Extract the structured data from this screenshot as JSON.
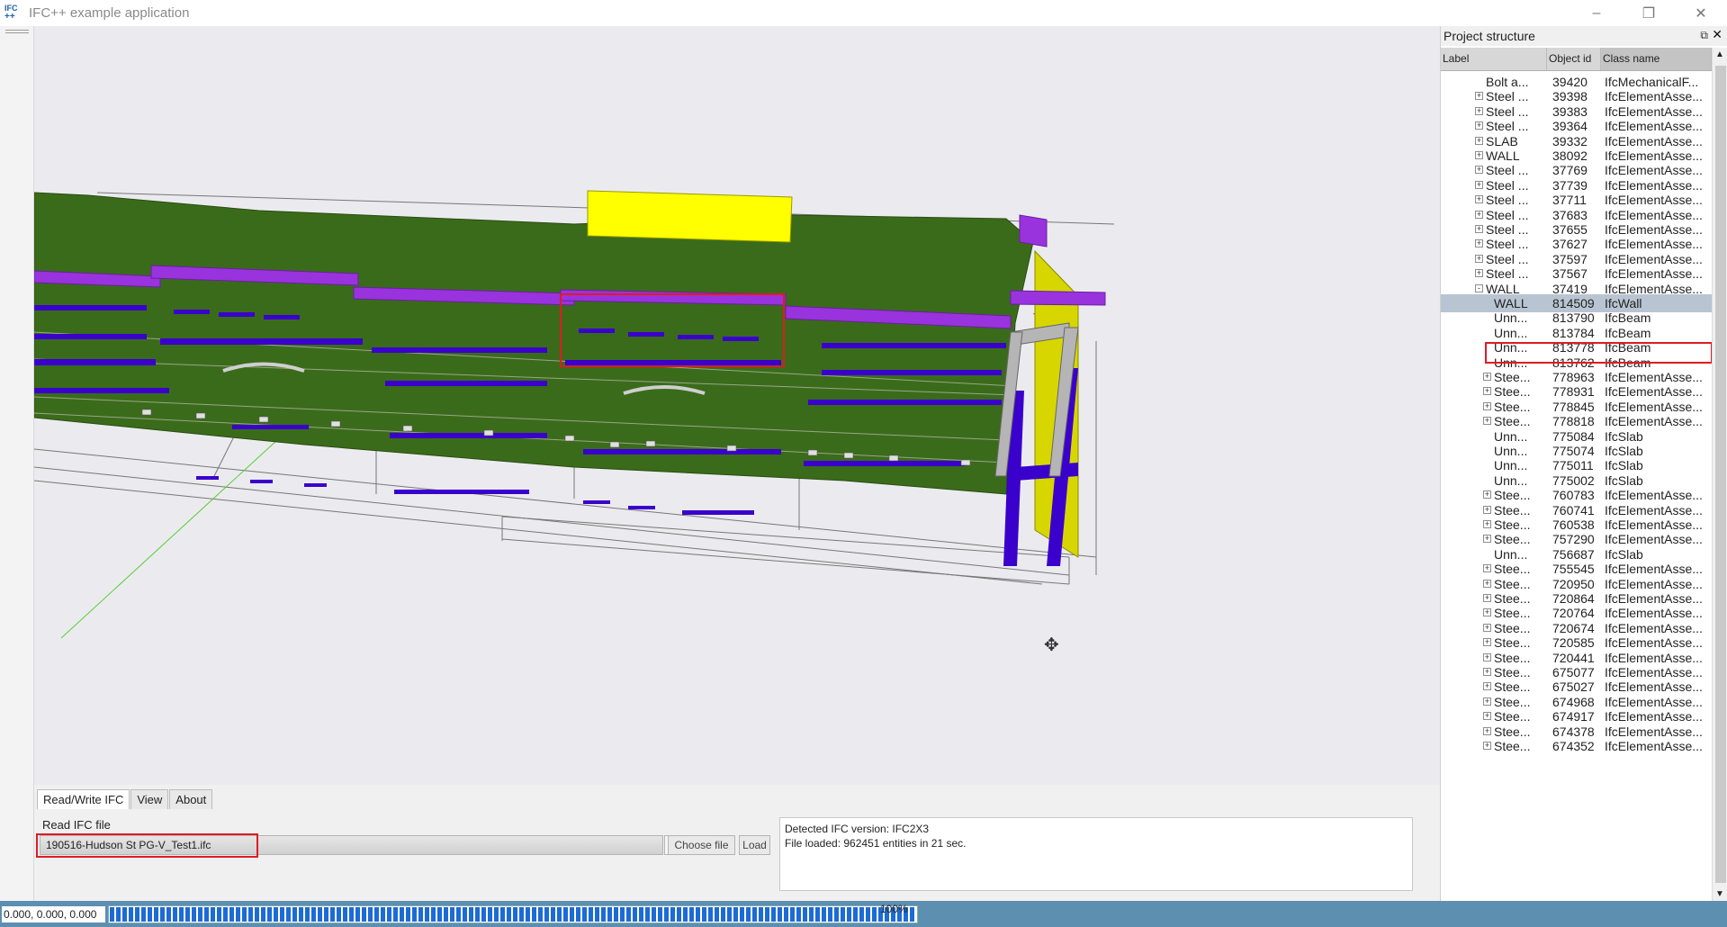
{
  "window": {
    "app_icon_top": "IFC",
    "app_icon_bottom": "++",
    "title": "IFC++ example application",
    "minimize": "–",
    "maximize": "❐",
    "close": "✕"
  },
  "viewport": {
    "description_icon": "move-cursor-icon",
    "cursor_glyph": "✥"
  },
  "tabs": [
    "Read/Write IFC",
    "View",
    "About"
  ],
  "read_ifc": {
    "section_label": "Read IFC file",
    "file_value": "190516-Hudson St PG-V_Test1.ifc",
    "choose_file_label": "Choose file",
    "load_label": "Load"
  },
  "log": {
    "line1": "Detected IFC version: IFC2X3",
    "line2": "File loaded: 962451 entities in 21 sec."
  },
  "status": {
    "coords": "0.000, 0.000, 0.000",
    "progress_percent": 100,
    "progress_text": "100%"
  },
  "project_structure": {
    "title": "Project structure",
    "float_icon": "⧉",
    "close_icon": "✕",
    "columns": {
      "label": "Label",
      "object_id": "Object id",
      "class_name": "Class name"
    },
    "rows": [
      {
        "depth": 0,
        "exp": "",
        "label": "Bolt a...",
        "id": "39420",
        "cls": "IfcMechanicalF..."
      },
      {
        "depth": 0,
        "exp": "+",
        "label": "Steel ...",
        "id": "39398",
        "cls": "IfcElementAsse..."
      },
      {
        "depth": 0,
        "exp": "+",
        "label": "Steel ...",
        "id": "39383",
        "cls": "IfcElementAsse..."
      },
      {
        "depth": 0,
        "exp": "+",
        "label": "Steel ...",
        "id": "39364",
        "cls": "IfcElementAsse..."
      },
      {
        "depth": 0,
        "exp": "+",
        "label": "SLAB",
        "id": "39332",
        "cls": "IfcElementAsse..."
      },
      {
        "depth": 0,
        "exp": "+",
        "label": "WALL",
        "id": "38092",
        "cls": "IfcElementAsse..."
      },
      {
        "depth": 0,
        "exp": "+",
        "label": "Steel ...",
        "id": "37769",
        "cls": "IfcElementAsse..."
      },
      {
        "depth": 0,
        "exp": "+",
        "label": "Steel ...",
        "id": "37739",
        "cls": "IfcElementAsse..."
      },
      {
        "depth": 0,
        "exp": "+",
        "label": "Steel ...",
        "id": "37711",
        "cls": "IfcElementAsse..."
      },
      {
        "depth": 0,
        "exp": "+",
        "label": "Steel ...",
        "id": "37683",
        "cls": "IfcElementAsse..."
      },
      {
        "depth": 0,
        "exp": "+",
        "label": "Steel ...",
        "id": "37655",
        "cls": "IfcElementAsse..."
      },
      {
        "depth": 0,
        "exp": "+",
        "label": "Steel ...",
        "id": "37627",
        "cls": "IfcElementAsse..."
      },
      {
        "depth": 0,
        "exp": "+",
        "label": "Steel ...",
        "id": "37597",
        "cls": "IfcElementAsse..."
      },
      {
        "depth": 0,
        "exp": "+",
        "label": "Steel ...",
        "id": "37567",
        "cls": "IfcElementAsse..."
      },
      {
        "depth": 0,
        "exp": "-",
        "label": "WALL",
        "id": "37419",
        "cls": "IfcElementAsse..."
      },
      {
        "depth": 1,
        "exp": "",
        "label": "WALL",
        "id": "814509",
        "cls": "IfcWall",
        "selected": true
      },
      {
        "depth": 1,
        "exp": "",
        "label": "Unn...",
        "id": "813790",
        "cls": "IfcBeam"
      },
      {
        "depth": 1,
        "exp": "",
        "label": "Unn...",
        "id": "813784",
        "cls": "IfcBeam"
      },
      {
        "depth": 1,
        "exp": "",
        "label": "Unn...",
        "id": "813778",
        "cls": "IfcBeam"
      },
      {
        "depth": 1,
        "exp": "",
        "label": "Unn...",
        "id": "813762",
        "cls": "IfcBeam"
      },
      {
        "depth": 1,
        "exp": "+",
        "label": "Stee...",
        "id": "778963",
        "cls": "IfcElementAsse..."
      },
      {
        "depth": 1,
        "exp": "+",
        "label": "Stee...",
        "id": "778931",
        "cls": "IfcElementAsse..."
      },
      {
        "depth": 1,
        "exp": "+",
        "label": "Stee...",
        "id": "778845",
        "cls": "IfcElementAsse..."
      },
      {
        "depth": 1,
        "exp": "+",
        "label": "Stee...",
        "id": "778818",
        "cls": "IfcElementAsse..."
      },
      {
        "depth": 1,
        "exp": "",
        "label": "Unn...",
        "id": "775084",
        "cls": "IfcSlab"
      },
      {
        "depth": 1,
        "exp": "",
        "label": "Unn...",
        "id": "775074",
        "cls": "IfcSlab"
      },
      {
        "depth": 1,
        "exp": "",
        "label": "Unn...",
        "id": "775011",
        "cls": "IfcSlab"
      },
      {
        "depth": 1,
        "exp": "",
        "label": "Unn...",
        "id": "775002",
        "cls": "IfcSlab"
      },
      {
        "depth": 1,
        "exp": "+",
        "label": "Stee...",
        "id": "760783",
        "cls": "IfcElementAsse..."
      },
      {
        "depth": 1,
        "exp": "+",
        "label": "Stee...",
        "id": "760741",
        "cls": "IfcElementAsse..."
      },
      {
        "depth": 1,
        "exp": "+",
        "label": "Stee...",
        "id": "760538",
        "cls": "IfcElementAsse..."
      },
      {
        "depth": 1,
        "exp": "+",
        "label": "Stee...",
        "id": "757290",
        "cls": "IfcElementAsse..."
      },
      {
        "depth": 1,
        "exp": "",
        "label": "Unn...",
        "id": "756687",
        "cls": "IfcSlab"
      },
      {
        "depth": 1,
        "exp": "+",
        "label": "Stee...",
        "id": "755545",
        "cls": "IfcElementAsse..."
      },
      {
        "depth": 1,
        "exp": "+",
        "label": "Stee...",
        "id": "720950",
        "cls": "IfcElementAsse..."
      },
      {
        "depth": 1,
        "exp": "+",
        "label": "Stee...",
        "id": "720864",
        "cls": "IfcElementAsse..."
      },
      {
        "depth": 1,
        "exp": "+",
        "label": "Stee...",
        "id": "720764",
        "cls": "IfcElementAsse..."
      },
      {
        "depth": 1,
        "exp": "+",
        "label": "Stee...",
        "id": "720674",
        "cls": "IfcElementAsse..."
      },
      {
        "depth": 1,
        "exp": "+",
        "label": "Stee...",
        "id": "720585",
        "cls": "IfcElementAsse..."
      },
      {
        "depth": 1,
        "exp": "+",
        "label": "Stee...",
        "id": "720441",
        "cls": "IfcElementAsse..."
      },
      {
        "depth": 1,
        "exp": "+",
        "label": "Stee...",
        "id": "675077",
        "cls": "IfcElementAsse..."
      },
      {
        "depth": 1,
        "exp": "+",
        "label": "Stee...",
        "id": "675027",
        "cls": "IfcElementAsse..."
      },
      {
        "depth": 1,
        "exp": "+",
        "label": "Stee...",
        "id": "674968",
        "cls": "IfcElementAsse..."
      },
      {
        "depth": 1,
        "exp": "+",
        "label": "Stee...",
        "id": "674917",
        "cls": "IfcElementAsse..."
      },
      {
        "depth": 1,
        "exp": "+",
        "label": "Stee...",
        "id": "674378",
        "cls": "IfcElementAsse..."
      },
      {
        "depth": 1,
        "exp": "+",
        "label": "Stee...",
        "id": "674352",
        "cls": "IfcElementAsse..."
      }
    ]
  },
  "colors": {
    "slab_green": "#3a6b1a",
    "beam_purple": "#9933dd",
    "member_blue": "#3a00cc",
    "highlight_yellow": "#ffff00",
    "highlight_red": "#e01b24",
    "status_bar": "#5d8fb0"
  }
}
